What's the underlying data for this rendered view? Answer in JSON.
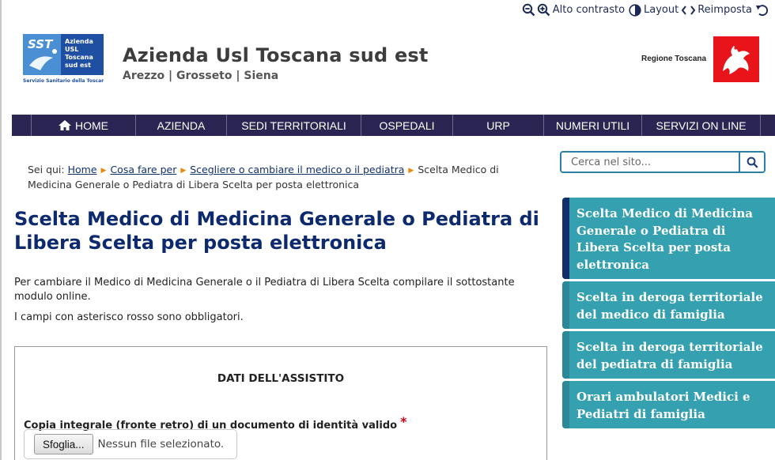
{
  "accessibility_toolbar": {
    "zoom_out_icon": "zoom-out-icon",
    "zoom_in_icon": "zoom-in-icon",
    "high_contrast_label": "Alto contrasto",
    "layout_label": "Layout",
    "reset_label": "Reimposta"
  },
  "header": {
    "logo_text": [
      "SST",
      "Azienda",
      "USL",
      "Toscana",
      "sud est",
      "Servizio Sanitario della Toscana"
    ],
    "title": "Azienda Usl Toscana sud est",
    "subtitle": "Arezzo | Grosseto | Siena",
    "region_label": "Regione Toscana"
  },
  "nav": {
    "items": [
      {
        "label": "HOME",
        "icon": "home-icon"
      },
      {
        "label": "AZIENDA"
      },
      {
        "label": "SEDI TERRITORIALI"
      },
      {
        "label": "OSPEDALI"
      },
      {
        "label": "URP"
      },
      {
        "label": "NUMERI UTILI"
      },
      {
        "label": "SERVIZI ON LINE"
      }
    ]
  },
  "search": {
    "placeholder": "Cerca nel sito...",
    "button_icon": "search-icon"
  },
  "breadcrumb": {
    "prefix": "Sei qui:",
    "links": [
      "Home",
      "Cosa fare per",
      "Scegliere o cambiare il medico o il pediatra"
    ],
    "current": "Scelta Medico di Medicina Generale o Pediatra di Libera Scelta per posta elettronica"
  },
  "main": {
    "title": "Scelta Medico di Medicina Generale o Pediatra di Libera Scelta per posta elettronica",
    "intro": "Per cambiare il Medico di Medicina Generale o il Pediatra di Libera Scelta compilare il sottostante modulo online.",
    "required_note": "I campi con asterisco rosso sono obbligatori.",
    "form": {
      "section_title": "DATI DELL'ASSISTITO",
      "field_label": "Copia integrale (fronte retro) di un documento di identità valido",
      "required_mark": "*",
      "browse_label": "Sfoglia...",
      "no_file_text": "Nessun file selezionato."
    }
  },
  "sidebar": {
    "items": [
      {
        "label": "Scelta Medico di Medicina Generale o Pediatra di Libera Scelta per posta elettronica",
        "active": true
      },
      {
        "label": "Scelta in deroga territoriale del medico di famiglia",
        "active": false
      },
      {
        "label": "Scelta in deroga territoriale del pediatra di famiglia",
        "active": false
      },
      {
        "label": "Orari ambulatori Medici e Pediatri di famiglia",
        "active": false
      }
    ]
  },
  "colors": {
    "nav_bg": "#2a2553",
    "title_blue": "#0d2a6e",
    "sidebar_teal": "#35a0b0",
    "sidebar_active_bar": "#122f6b",
    "required_red": "#d0021b",
    "region_red": "#e8141a"
  }
}
